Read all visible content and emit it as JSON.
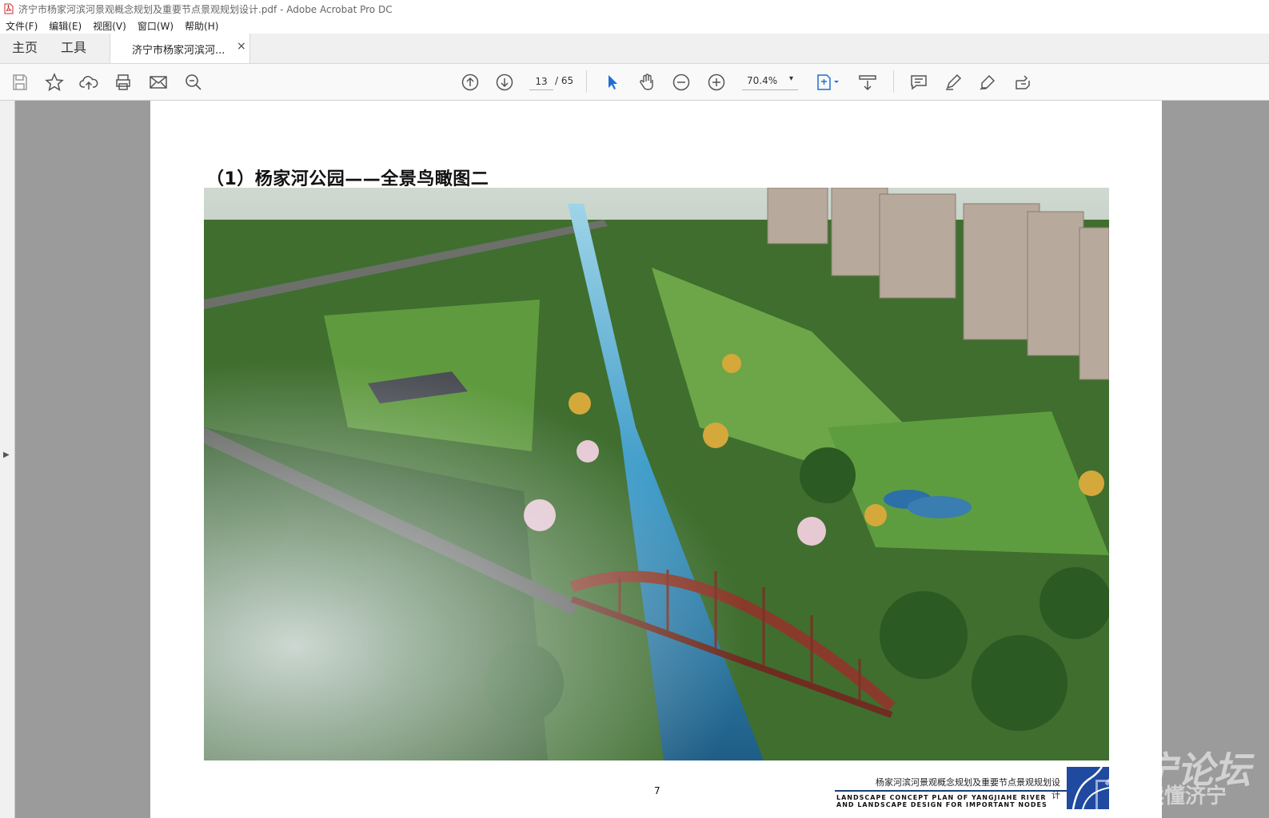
{
  "window": {
    "title": "济宁市杨家河滨河景观概念规划及重要节点景观规划设计.pdf - Adobe Acrobat Pro DC"
  },
  "menu": [
    "文件(F)",
    "编辑(E)",
    "视图(V)",
    "窗口(W)",
    "帮助(H)"
  ],
  "nav": {
    "home": "主页",
    "tools": "工具",
    "doc_tab": "济宁市杨家河滨河...",
    "close": "×"
  },
  "toolbar": {
    "icons": [
      "save-icon",
      "star-icon",
      "upload-icon",
      "print-icon",
      "email-icon",
      "search-icon",
      "prev-page-icon",
      "next-page-icon",
      "select-cursor-icon",
      "hand-icon",
      "zoom-out-icon",
      "zoom-in-icon",
      "fit-page-icon",
      "scroll-mode-icon",
      "comment-icon",
      "highlight-icon",
      "sign-icon",
      "share-icon"
    ],
    "page_current": "13",
    "page_total": "/ 65",
    "zoom": "70.4%",
    "zoom_caret": "▾"
  },
  "document": {
    "heading": "（1）杨家河公园——全景鸟瞰图二",
    "page_number": "7",
    "footer_cn": "杨家河滨河景观概念规划及重要节点景观规划设计",
    "footer_en_line1": "LANDSCAPE CONCEPT PLAN OF YANGJIAHE RIVER",
    "footer_en_line2": "AND LANDSCAPE DESIGN FOR IMPORTANT NODES"
  },
  "watermark": {
    "line1": "济宁论坛",
    "line2": "读懂济宁",
    "box": "在"
  },
  "colors": {
    "accent": "#1f4aa0",
    "toolbar_bg": "#f9f9f9",
    "viewer_bg": "#9b9b9b"
  }
}
